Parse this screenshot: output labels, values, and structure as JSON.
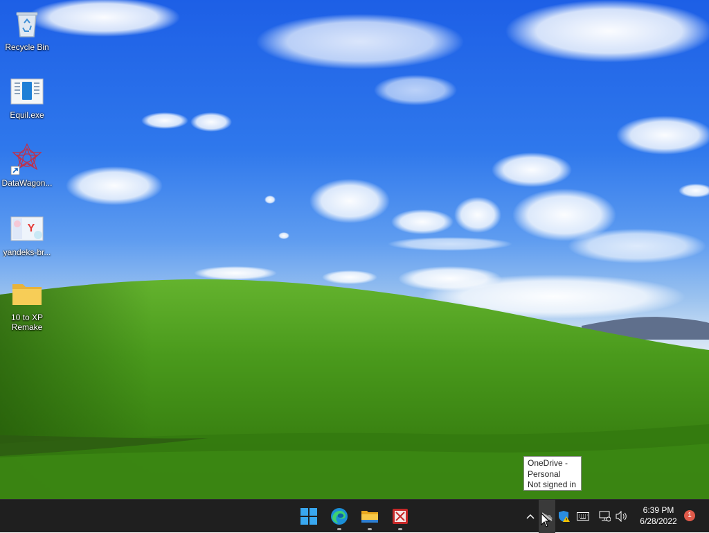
{
  "desktop": {
    "icons": [
      {
        "label": "Recycle Bin",
        "icon": "recycle-bin-icon"
      },
      {
        "label": "Equil.exe",
        "icon": "application-icon"
      },
      {
        "label": "DataWagon...",
        "icon": "datawagon-shortcut-icon"
      },
      {
        "label": "yandeks-br...",
        "icon": "image-file-icon"
      },
      {
        "label": "10 to XP Remake",
        "icon": "folder-icon"
      }
    ]
  },
  "tooltip": {
    "lines": [
      "OneDrive -",
      "Personal",
      "Not signed in"
    ]
  },
  "taskbar": {
    "apps": [
      {
        "name": "Start",
        "icon": "windows-start-icon"
      },
      {
        "name": "Microsoft Edge",
        "icon": "edge-icon"
      },
      {
        "name": "File Explorer",
        "icon": "file-explorer-icon"
      },
      {
        "name": "Image viewer",
        "icon": "image-app-icon"
      }
    ],
    "tray": {
      "icons": [
        "chevron-up-icon",
        "onedrive-icon",
        "windows-security-warning-icon",
        "keyboard-icon",
        "network-icon",
        "volume-icon"
      ],
      "time": "6:39 PM",
      "date": "6/28/2022",
      "notification_count": "1"
    }
  }
}
